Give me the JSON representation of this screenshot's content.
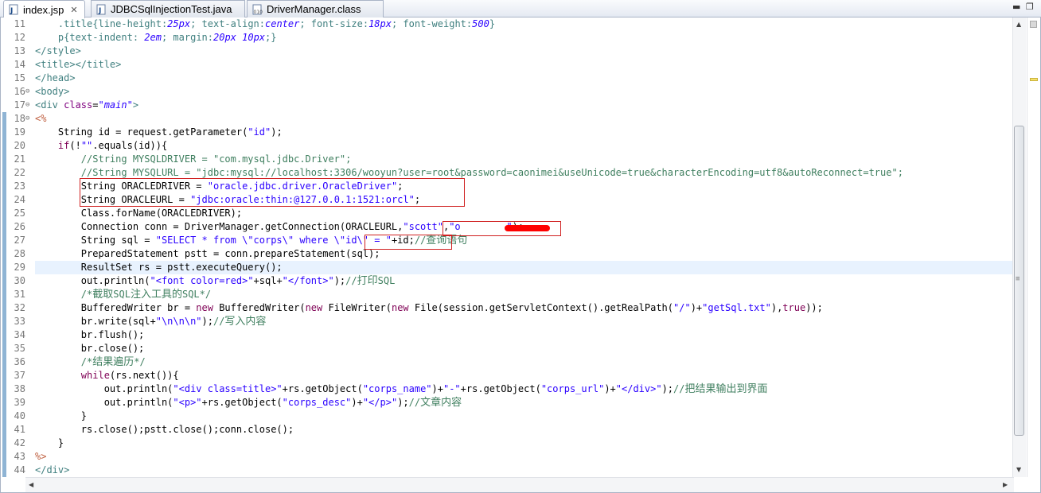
{
  "tabs": [
    {
      "label": "index.jsp",
      "icon": "jsp-file-icon",
      "active": true
    },
    {
      "label": "JDBCSqlInjectionTest.java",
      "icon": "java-file-icon",
      "active": false
    },
    {
      "label": "DriverManager.class",
      "icon": "class-file-icon",
      "active": false
    }
  ],
  "colors": {
    "keyword": "#7f0055",
    "string": "#2a00ff",
    "comment": "#3f7f5f",
    "tag": "#3f7f7f",
    "highlight": "#e8f2fe",
    "redbox": "#d02020"
  },
  "editor": {
    "line_numbers": [
      "11",
      "12",
      "13",
      "14",
      "15",
      "16",
      "17",
      "18",
      "19",
      "20",
      "21",
      "22",
      "23",
      "24",
      "25",
      "26",
      "27",
      "28",
      "29",
      "30",
      "31",
      "32",
      "33",
      "34",
      "35",
      "36",
      "37",
      "38",
      "39",
      "40",
      "41",
      "42",
      "43",
      "44"
    ],
    "current_line": "29",
    "lines": [
      [
        {
          "t": "    .title{line-height:",
          "c": "tag"
        },
        {
          "t": "25px",
          "c": "cssv"
        },
        {
          "t": "; text-align:",
          "c": "tag"
        },
        {
          "t": "center",
          "c": "cssv"
        },
        {
          "t": "; font-size:",
          "c": "tag"
        },
        {
          "t": "18px",
          "c": "cssv"
        },
        {
          "t": "; font-weight:",
          "c": "tag"
        },
        {
          "t": "500",
          "c": "cssv"
        },
        {
          "t": "}",
          "c": "tag"
        }
      ],
      [
        {
          "t": "    p{text-indent: ",
          "c": "tag"
        },
        {
          "t": "2em",
          "c": "cssv"
        },
        {
          "t": "; margin:",
          "c": "tag"
        },
        {
          "t": "20px 10px",
          "c": "cssv"
        },
        {
          "t": ";}",
          "c": "tag"
        }
      ],
      [
        {
          "t": "</style>",
          "c": "tag"
        }
      ],
      [
        {
          "t": "<title></title>",
          "c": "tag"
        }
      ],
      [
        {
          "t": "</head>",
          "c": "tag"
        }
      ],
      [
        {
          "t": "<body>",
          "c": "tag"
        }
      ],
      [
        {
          "t": "<div ",
          "c": "tag"
        },
        {
          "t": "class",
          "c": "attr"
        },
        {
          "t": "=",
          "c": ""
        },
        {
          "t": "\"main\"",
          "c": "aval"
        },
        {
          "t": ">",
          "c": "tag"
        }
      ],
      [
        {
          "t": "<%",
          "c": "jsp"
        }
      ],
      [
        {
          "t": "    String id = request.getParameter(",
          "c": ""
        },
        {
          "t": "\"id\"",
          "c": "s"
        },
        {
          "t": ");",
          "c": ""
        }
      ],
      [
        {
          "t": "    ",
          "c": ""
        },
        {
          "t": "if",
          "c": "k"
        },
        {
          "t": "(!",
          "c": ""
        },
        {
          "t": "\"\"",
          "c": "s"
        },
        {
          "t": ".equals(id)){",
          "c": ""
        }
      ],
      [
        {
          "t": "        //String MYSQLDRIVER = \"com.mysql.jdbc.Driver\";",
          "c": "c"
        }
      ],
      [
        {
          "t": "        //String MYSQLURL = \"jdbc:mysql://localhost:3306/wooyun?user=root&password=caonimei&useUnicode=true&characterEncoding=utf8&autoReconnect=true\";",
          "c": "c"
        }
      ],
      [
        {
          "t": "        String ORACLEDRIVER = ",
          "c": ""
        },
        {
          "t": "\"oracle.jdbc.driver.OracleDriver\"",
          "c": "s"
        },
        {
          "t": ";",
          "c": ""
        }
      ],
      [
        {
          "t": "        String ORACLEURL = ",
          "c": ""
        },
        {
          "t": "\"jdbc:oracle:thin:@127.0.0.1:1521:orcl\"",
          "c": "s"
        },
        {
          "t": ";",
          "c": ""
        }
      ],
      [
        {
          "t": "        Class.forName(ORACLEDRIVER);",
          "c": ""
        }
      ],
      [
        {
          "t": "        Connection conn = DriverManager.getConnection(ORACLEURL,",
          "c": ""
        },
        {
          "t": "\"scott\"",
          "c": "s"
        },
        {
          "t": ",",
          "c": ""
        },
        {
          "t": "\"o        \"",
          "c": "s"
        },
        {
          "t": ");",
          "c": ""
        }
      ],
      [
        {
          "t": "        String sql = ",
          "c": ""
        },
        {
          "t": "\"SELECT * from \\\"corps\\\" where \\\"id\\\" = \"",
          "c": "s"
        },
        {
          "t": "+id;",
          "c": ""
        },
        {
          "t": "//",
          "c": "c"
        },
        {
          "t": "查询语句",
          "c": "cz"
        }
      ],
      [
        {
          "t": "        PreparedStatement pstt = conn.prepareStatement(sql);",
          "c": ""
        }
      ],
      [
        {
          "t": "        ResultSet rs = pstt.executeQuery();",
          "c": ""
        }
      ],
      [
        {
          "t": "        out.println(",
          "c": ""
        },
        {
          "t": "\"<font color=red>\"",
          "c": "s"
        },
        {
          "t": "+sql+",
          "c": ""
        },
        {
          "t": "\"</font>\"",
          "c": "s"
        },
        {
          "t": ");",
          "c": ""
        },
        {
          "t": "//",
          "c": "c"
        },
        {
          "t": "打印",
          "c": "cz"
        },
        {
          "t": "SQL",
          "c": "c"
        }
      ],
      [
        {
          "t": "        /*",
          "c": "c"
        },
        {
          "t": "截取",
          "c": "cz"
        },
        {
          "t": "SQL",
          "c": "c"
        },
        {
          "t": "注入工具的",
          "c": "cz"
        },
        {
          "t": "SQL*/",
          "c": "c"
        }
      ],
      [
        {
          "t": "        BufferedWriter br = ",
          "c": ""
        },
        {
          "t": "new",
          "c": "k"
        },
        {
          "t": " BufferedWriter(",
          "c": ""
        },
        {
          "t": "new",
          "c": "k"
        },
        {
          "t": " FileWriter(",
          "c": ""
        },
        {
          "t": "new",
          "c": "k"
        },
        {
          "t": " File(session.getServletContext().getRealPath(",
          "c": ""
        },
        {
          "t": "\"/\"",
          "c": "s"
        },
        {
          "t": ")+",
          "c": ""
        },
        {
          "t": "\"getSql.txt\"",
          "c": "s"
        },
        {
          "t": "),",
          "c": ""
        },
        {
          "t": "true",
          "c": "k"
        },
        {
          "t": "));",
          "c": ""
        }
      ],
      [
        {
          "t": "        br.write(sql+",
          "c": ""
        },
        {
          "t": "\"\\n\\n\\n\"",
          "c": "s"
        },
        {
          "t": ");",
          "c": ""
        },
        {
          "t": "//",
          "c": "c"
        },
        {
          "t": "写入内容",
          "c": "cz"
        }
      ],
      [
        {
          "t": "        br.flush();",
          "c": ""
        }
      ],
      [
        {
          "t": "        br.close();",
          "c": ""
        }
      ],
      [
        {
          "t": "        /*",
          "c": "c"
        },
        {
          "t": "结果遍历",
          "c": "cz"
        },
        {
          "t": "*/",
          "c": "c"
        }
      ],
      [
        {
          "t": "        ",
          "c": ""
        },
        {
          "t": "while",
          "c": "k"
        },
        {
          "t": "(rs.next()){",
          "c": ""
        }
      ],
      [
        {
          "t": "            out.println(",
          "c": ""
        },
        {
          "t": "\"<div class=title>\"",
          "c": "s"
        },
        {
          "t": "+rs.getObject(",
          "c": ""
        },
        {
          "t": "\"corps_name\"",
          "c": "s"
        },
        {
          "t": ")+",
          "c": ""
        },
        {
          "t": "\"-\"",
          "c": "s"
        },
        {
          "t": "+rs.getObject(",
          "c": ""
        },
        {
          "t": "\"corps_url\"",
          "c": "s"
        },
        {
          "t": ")+",
          "c": ""
        },
        {
          "t": "\"</div>\"",
          "c": "s"
        },
        {
          "t": ");",
          "c": ""
        },
        {
          "t": "//",
          "c": "c"
        },
        {
          "t": "把结果输出到界面",
          "c": "cz"
        }
      ],
      [
        {
          "t": "            out.println(",
          "c": ""
        },
        {
          "t": "\"<p>\"",
          "c": "s"
        },
        {
          "t": "+rs.getObject(",
          "c": ""
        },
        {
          "t": "\"corps_desc\"",
          "c": "s"
        },
        {
          "t": ")+",
          "c": ""
        },
        {
          "t": "\"</p>\"",
          "c": "s"
        },
        {
          "t": ");",
          "c": ""
        },
        {
          "t": "//",
          "c": "c"
        },
        {
          "t": "文章内容",
          "c": "cz"
        }
      ],
      [
        {
          "t": "        }",
          "c": ""
        }
      ],
      [
        {
          "t": "        rs.close();pstt.close();conn.close();",
          "c": ""
        }
      ],
      [
        {
          "t": "    }",
          "c": ""
        }
      ],
      [
        {
          "t": "%>",
          "c": "jsp"
        }
      ],
      [
        {
          "t": "</div>",
          "c": "tag"
        }
      ]
    ]
  }
}
